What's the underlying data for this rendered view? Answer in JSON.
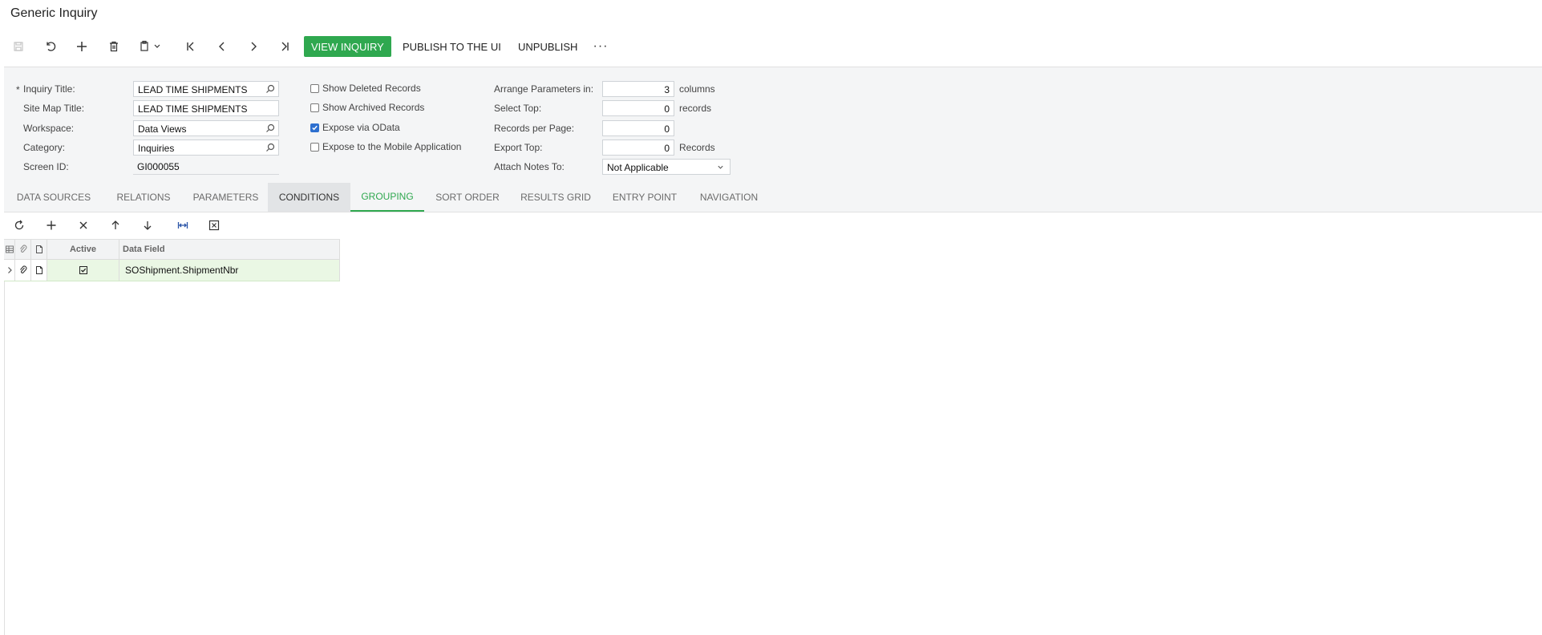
{
  "page": {
    "title": "Generic Inquiry"
  },
  "colors": {
    "primary": "#2fa84f",
    "active_tab": "#2fa84f",
    "checkbox": "#2d6fcf",
    "selected_row": "#eaf7e4"
  },
  "toolbar": {
    "icons": [
      "save-icon",
      "undo-icon",
      "add-icon",
      "delete-icon",
      "copy-paste-icon",
      "first-record-icon",
      "previous-record-icon",
      "next-record-icon",
      "last-record-icon"
    ],
    "view_inquiry": "VIEW INQUIRY",
    "publish": "PUBLISH TO THE UI",
    "unpublish": "UNPUBLISH",
    "more": "···"
  },
  "form": {
    "required_mark": "*",
    "inquiry_title": {
      "label": "Inquiry Title:",
      "value": "LEAD TIME SHIPMENTS"
    },
    "site_map_title": {
      "label": "Site Map Title:",
      "value": "LEAD TIME SHIPMENTS"
    },
    "workspace": {
      "label": "Workspace:",
      "value": "Data Views"
    },
    "category": {
      "label": "Category:",
      "value": "Inquiries"
    },
    "screen_id": {
      "label": "Screen ID:",
      "value": "GI000055"
    },
    "show_deleted": {
      "label": "Show Deleted Records",
      "checked": false
    },
    "show_archived": {
      "label": "Show Archived Records",
      "checked": false
    },
    "expose_odata": {
      "label": "Expose via OData",
      "checked": true
    },
    "expose_mobile": {
      "label": "Expose to the Mobile Application",
      "checked": false
    },
    "arrange_params": {
      "label": "Arrange Parameters in:",
      "value": "3",
      "suffix": "columns"
    },
    "select_top": {
      "label": "Select Top:",
      "value": "0",
      "suffix": "records"
    },
    "records_per_page": {
      "label": "Records per Page:",
      "value": "0"
    },
    "export_top": {
      "label": "Export Top:",
      "value": "0",
      "suffix": "Records"
    },
    "attach_notes": {
      "label": "Attach Notes To:",
      "value": "Not Applicable"
    }
  },
  "tabs": [
    {
      "label": "DATA SOURCES"
    },
    {
      "label": "RELATIONS"
    },
    {
      "label": "PARAMETERS"
    },
    {
      "label": "CONDITIONS"
    },
    {
      "label": "GROUPING"
    },
    {
      "label": "SORT ORDER"
    },
    {
      "label": "RESULTS GRID"
    },
    {
      "label": "ENTRY POINT"
    },
    {
      "label": "NAVIGATION"
    }
  ],
  "active_tab": "GROUPING",
  "grid_toolbar": {
    "icons": [
      "refresh-icon",
      "add-row-icon",
      "delete-row-icon",
      "move-up-icon",
      "move-down-icon",
      "fit-columns-icon",
      "export-excel-icon"
    ]
  },
  "grid": {
    "columns": [
      "Active",
      "Data Field"
    ],
    "rows": [
      {
        "active": true,
        "data_field": "SOShipment.ShipmentNbr"
      }
    ]
  }
}
